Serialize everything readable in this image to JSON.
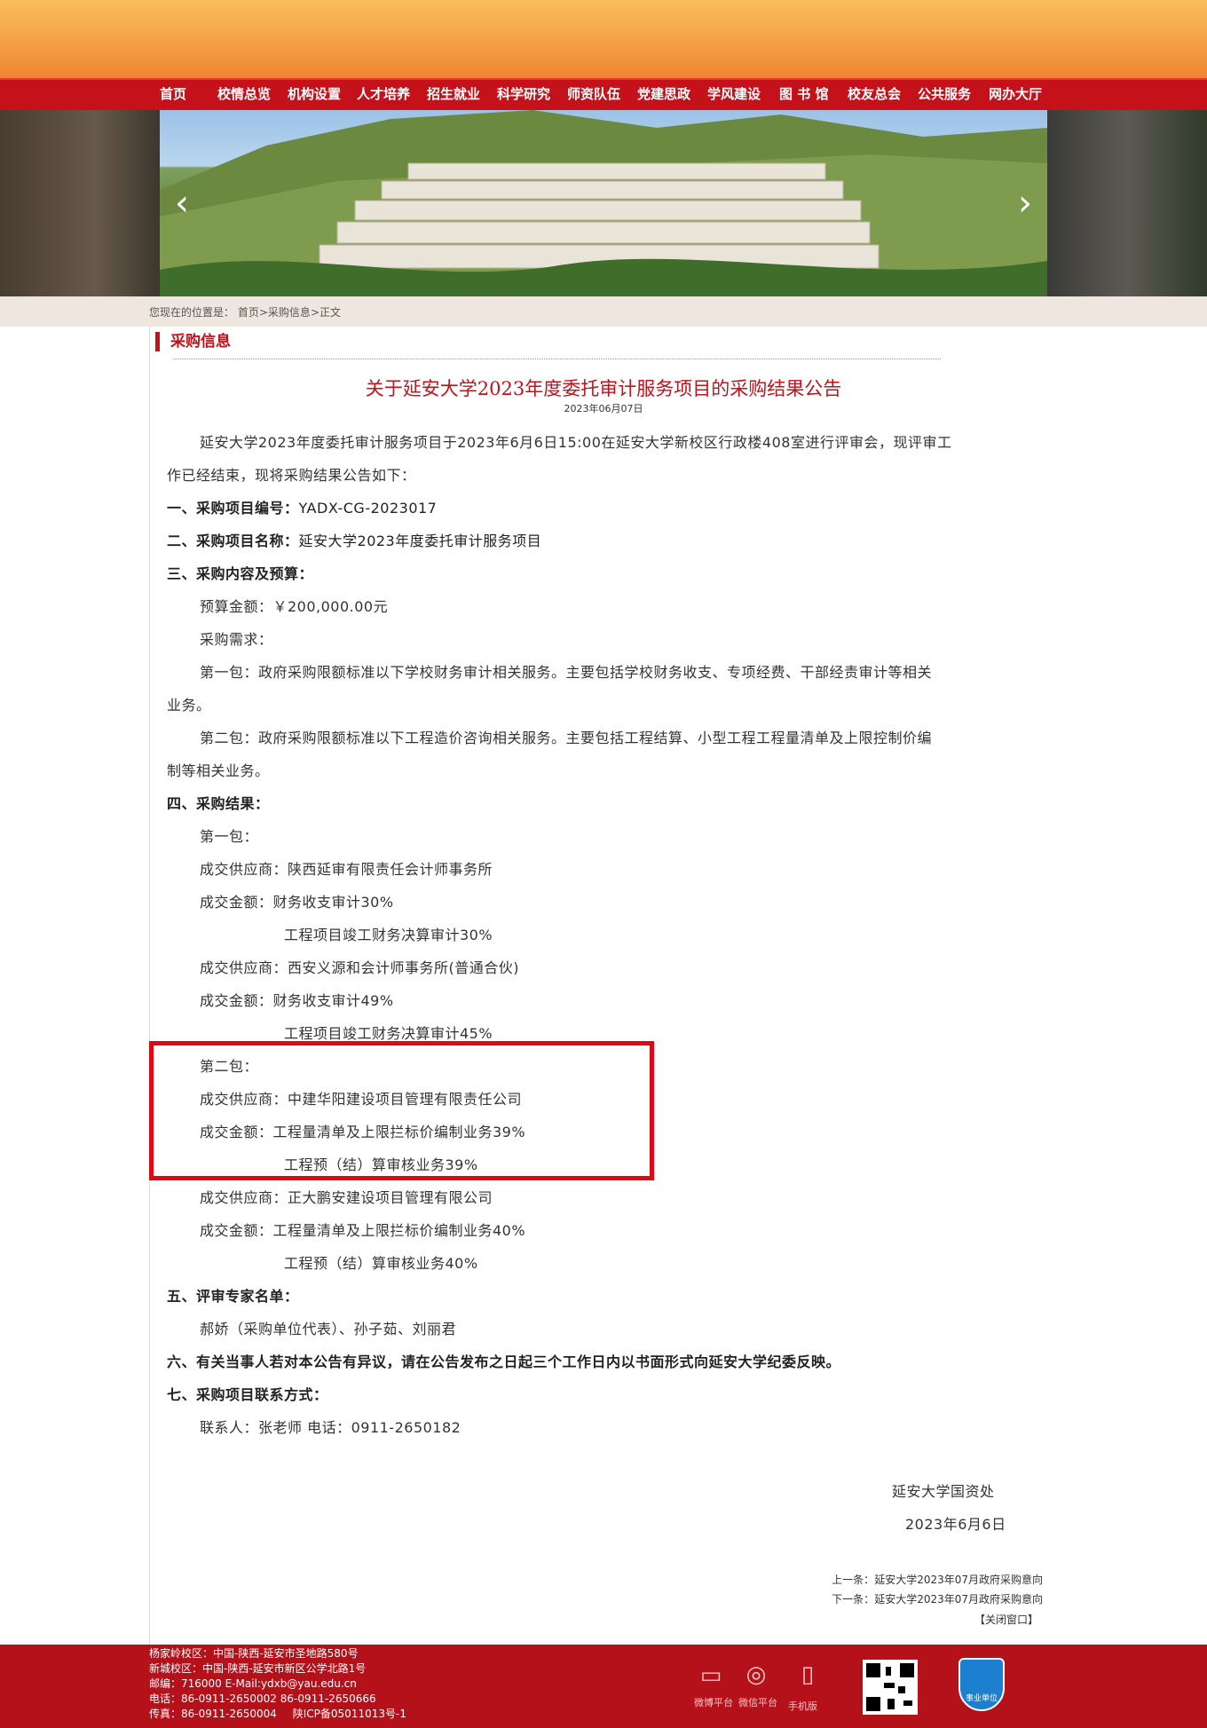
{
  "nav": {
    "items": [
      "首页",
      "校情总览",
      "机构设置",
      "人才培养",
      "招生就业",
      "科学研究",
      "师资队伍",
      "党建思政",
      "学风建设",
      "图 书 馆",
      "校友总会",
      "公共服务",
      "网办大厅"
    ]
  },
  "breadcrumb": {
    "prefix": "您现在的位置是：",
    "home": "首页",
    "section": "采购信息",
    "current": "正文",
    "sep": ">"
  },
  "section_title": "采购信息",
  "article": {
    "title": "关于延安大学2023年度委托审计服务项目的采购结果公告",
    "date": "2023年06月07日",
    "lines": [
      {
        "text": "延安大学2023年度委托审计服务项目于2023年6月6日15:00在延安大学新校区行政楼408室进行评审会，现评审工",
        "bold": false
      },
      {
        "text": "作已经结束，现将采购结果公告如下：",
        "bold": false
      },
      {
        "text": "一、采购项目编号：",
        "bold": true,
        "tail": "YADX-CG-2023017"
      },
      {
        "text": "二、采购项目名称：",
        "bold": true,
        "tail": "延安大学2023年度委托审计服务项目"
      },
      {
        "text": "三、采购内容及预算：",
        "bold": true
      },
      {
        "text": "预算金额：￥200,000.00元",
        "bold": false
      },
      {
        "text": "采购需求：",
        "bold": false
      },
      {
        "text": "第一包：政府采购限额标准以下学校财务审计相关服务。主要包括学校财务收支、专项经费、干部经责审计等相关",
        "bold": false
      },
      {
        "text": "业务。",
        "bold": false
      },
      {
        "text": "第二包：政府采购限额标准以下工程造价咨询相关服务。主要包括工程结算、小型工程工程量清单及上限控制价编",
        "bold": false
      },
      {
        "text": "制等相关业务。",
        "bold": false
      },
      {
        "text": "四、采购结果：",
        "bold": true
      },
      {
        "text": "第一包：",
        "bold": false
      },
      {
        "text": "成交供应商：陕西延审有限责任会计师事务所",
        "bold": false
      },
      {
        "text": "成交金额：财务收支审计30%",
        "bold": false
      },
      {
        "text": "工程项目竣工财务决算审计30%",
        "bold": false
      },
      {
        "text": "成交供应商：西安义源和会计师事务所(普通合伙)",
        "bold": false
      },
      {
        "text": "成交金额：财务收支审计49%",
        "bold": false
      },
      {
        "text": "工程项目竣工财务决算审计45%",
        "bold": false
      },
      {
        "text": "第二包：",
        "bold": false
      },
      {
        "text": "成交供应商：中建华阳建设项目管理有限责任公司",
        "bold": false
      },
      {
        "text": "成交金额：工程量清单及上限拦标价编制业务39%",
        "bold": false
      },
      {
        "text": "工程预（结）算审核业务39%",
        "bold": false
      },
      {
        "text": "成交供应商：正大鹏安建设项目管理有限公司",
        "bold": false
      },
      {
        "text": "成交金额：工程量清单及上限拦标价编制业务40%",
        "bold": false
      },
      {
        "text": "工程预（结）算审核业务40%",
        "bold": false
      },
      {
        "text": "五、评审专家名单：",
        "bold": true
      },
      {
        "text": "郝娇（采购单位代表）、孙子茹、刘丽君",
        "bold": false
      },
      {
        "text": "六、有关当事人若对本公告有异议，请在公告发布之日起三个工作日内以书面形式向延安大学纪委反映。",
        "bold": true
      },
      {
        "text": "七、采购项目联系方式：",
        "bold": true
      },
      {
        "text": "联系人：张老师        电话：0911-2650182",
        "bold": false
      }
    ],
    "signature": "延安大学国资处",
    "sign_date": "2023年6月6日"
  },
  "prev_next": {
    "prev_label": "上一条：",
    "prev": "延安大学2023年07月政府采购意向",
    "next_label": "下一条：",
    "next": "延安大学2023年07月政府采购意向",
    "close": "【关闭窗口】"
  },
  "footer": {
    "lines": [
      "杨家岭校区：中国-陕西-延安市圣地路580号",
      "新城校区：中国-陕西-延安市新区公学北路1号",
      "邮编：716000    E-Mail:ydxb@yau.edu.cn",
      "电话：86-0911-2650002   86-0911-2650666",
      "传真：86-0911-2650004"
    ],
    "icp": "陕ICP备05011013号-1",
    "links": [
      "微博平台",
      "微信平台",
      "手机版"
    ],
    "badge": "事业单位",
    "accent": "#b5111b"
  },
  "colors": {
    "brand_red": "#c4111a",
    "highlight": "#e30613"
  }
}
